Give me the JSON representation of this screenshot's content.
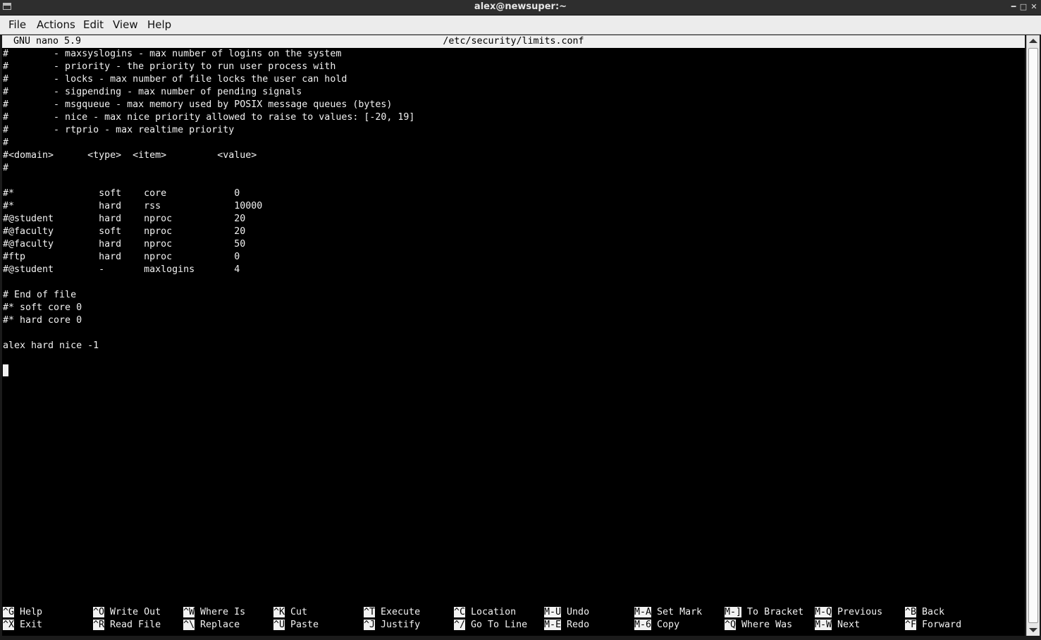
{
  "window": {
    "title": "alex@newsuper:~"
  },
  "menu": [
    "File",
    "Actions",
    "Edit",
    "View",
    "Help"
  ],
  "nano": {
    "version": "GNU nano 5.9",
    "filename": "/etc/security/limits.conf"
  },
  "buffer_lines": [
    "#        - maxsyslogins - max number of logins on the system",
    "#        - priority - the priority to run user process with",
    "#        - locks - max number of file locks the user can hold",
    "#        - sigpending - max number of pending signals",
    "#        - msgqueue - max memory used by POSIX message queues (bytes)",
    "#        - nice - max nice priority allowed to raise to values: [-20, 19]",
    "#        - rtprio - max realtime priority",
    "#",
    "#<domain>      <type>  <item>         <value>",
    "#",
    "",
    "#*               soft    core            0",
    "#*               hard    rss             10000",
    "#@student        hard    nproc           20",
    "#@faculty        soft    nproc           20",
    "#@faculty        hard    nproc           50",
    "#ftp             hard    nproc           0",
    "#@student        -       maxlogins       4",
    "",
    "# End of file",
    "#* soft core 0",
    "#* hard core 0",
    "",
    "alex hard nice -1",
    "",
    ""
  ],
  "shortcuts": [
    [
      {
        "key": "^G",
        "label": "Help"
      },
      {
        "key": "^X",
        "label": "Exit"
      }
    ],
    [
      {
        "key": "^O",
        "label": "Write Out"
      },
      {
        "key": "^R",
        "label": "Read File"
      }
    ],
    [
      {
        "key": "^W",
        "label": "Where Is"
      },
      {
        "key": "^\\",
        "label": "Replace"
      }
    ],
    [
      {
        "key": "^K",
        "label": "Cut"
      },
      {
        "key": "^U",
        "label": "Paste"
      }
    ],
    [
      {
        "key": "^T",
        "label": "Execute"
      },
      {
        "key": "^J",
        "label": "Justify"
      }
    ],
    [
      {
        "key": "^C",
        "label": "Location"
      },
      {
        "key": "^/",
        "label": "Go To Line"
      }
    ],
    [
      {
        "key": "M-U",
        "label": "Undo"
      },
      {
        "key": "M-E",
        "label": "Redo"
      }
    ],
    [
      {
        "key": "M-A",
        "label": "Set Mark"
      },
      {
        "key": "M-6",
        "label": "Copy"
      }
    ],
    [
      {
        "key": "M-]",
        "label": "To Bracket"
      },
      {
        "key": "^Q",
        "label": "Where Was"
      }
    ],
    [
      {
        "key": "M-Q",
        "label": "Previous"
      },
      {
        "key": "M-W",
        "label": "Next"
      }
    ],
    [
      {
        "key": "^B",
        "label": "Back"
      },
      {
        "key": "^F",
        "label": "Forward"
      }
    ]
  ],
  "icons": {
    "window_menu": "window-icon",
    "minimize": "minimize-icon",
    "maximize": "maximize-icon",
    "close": "close-icon"
  }
}
